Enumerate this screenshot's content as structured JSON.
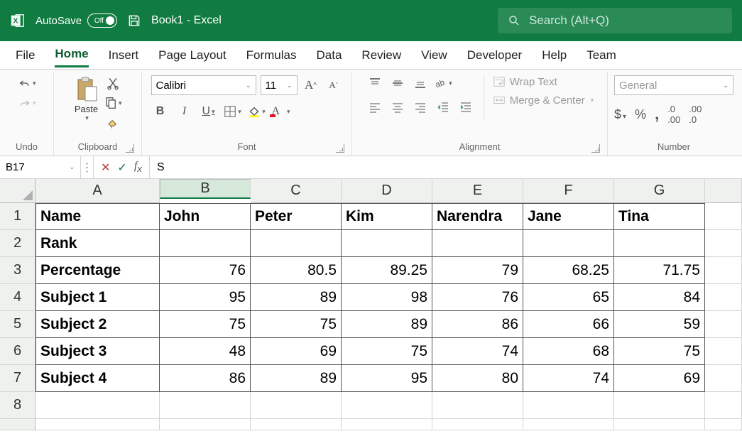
{
  "titlebar": {
    "autosave_label": "AutoSave",
    "autosave_state": "Off",
    "doc_title": "Book1  -  Excel",
    "search_placeholder": "Search (Alt+Q)"
  },
  "tabs": [
    "File",
    "Home",
    "Insert",
    "Page Layout",
    "Formulas",
    "Data",
    "Review",
    "View",
    "Developer",
    "Help",
    "Team"
  ],
  "active_tab": "Home",
  "ribbon": {
    "undo_label": "Undo",
    "clipboard": {
      "label": "Clipboard",
      "paste": "Paste"
    },
    "font": {
      "label": "Font",
      "name": "Calibri",
      "size": "11",
      "bold": "B",
      "italic": "I",
      "underline": "U"
    },
    "alignment": {
      "label": "Alignment",
      "wrap": "Wrap Text",
      "merge": "Merge & Center"
    },
    "number": {
      "label": "Number",
      "format": "General",
      "currency": "$",
      "percent": "%",
      "comma": "，"
    }
  },
  "namebox": {
    "ref": "B17",
    "formula": "S"
  },
  "columns": [
    "A",
    "B",
    "C",
    "D",
    "E",
    "F",
    "G"
  ],
  "selected_col": "B",
  "rows": [
    "1",
    "2",
    "3",
    "4",
    "5",
    "6",
    "7",
    "8"
  ],
  "chart_data": {
    "type": "table",
    "headers": [
      "Name",
      "John",
      "Peter",
      "Kim",
      "Narendra",
      "Jane",
      "Tina"
    ],
    "rows": [
      {
        "label": "Rank",
        "values": [
          "",
          "",
          "",
          "",
          "",
          ""
        ]
      },
      {
        "label": "Percentage",
        "values": [
          76,
          80.5,
          89.25,
          79,
          68.25,
          71.75
        ]
      },
      {
        "label": "Subject 1",
        "values": [
          95,
          89,
          98,
          76,
          65,
          84
        ]
      },
      {
        "label": "Subject 2",
        "values": [
          75,
          75,
          89,
          86,
          66,
          59
        ]
      },
      {
        "label": "Subject 3",
        "values": [
          48,
          69,
          75,
          74,
          68,
          75
        ]
      },
      {
        "label": "Subject 4",
        "values": [
          86,
          89,
          95,
          80,
          74,
          69
        ]
      }
    ]
  }
}
